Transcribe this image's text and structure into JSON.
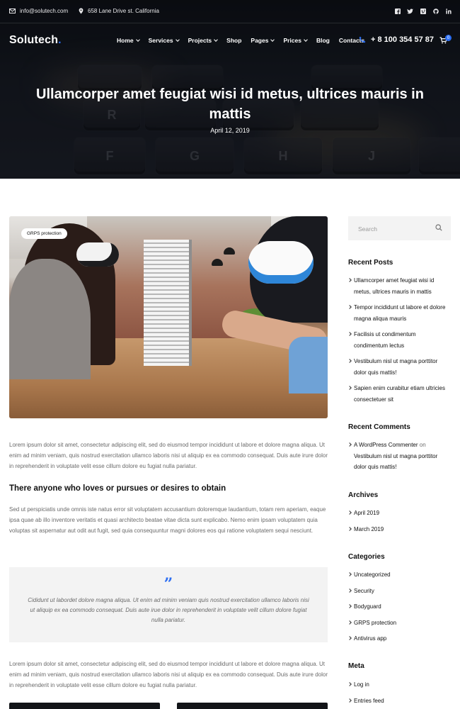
{
  "topbar": {
    "email": "info@solutech.com",
    "address": "658 Lane Drive st. California",
    "socials": [
      "facebook-icon",
      "twitter-icon",
      "vimeo-icon",
      "github-icon",
      "linkedin-icon"
    ]
  },
  "nav": {
    "logo": "Solutech",
    "items": [
      {
        "label": "Home",
        "dropdown": true
      },
      {
        "label": "Services",
        "dropdown": true
      },
      {
        "label": "Projects",
        "dropdown": true
      },
      {
        "label": "Shop",
        "dropdown": false
      },
      {
        "label": "Pages",
        "dropdown": true
      },
      {
        "label": "Prices",
        "dropdown": true
      },
      {
        "label": "Blog",
        "dropdown": false
      },
      {
        "label": "Contacts",
        "dropdown": false
      }
    ],
    "phone": "+ 8 100 354 57 87",
    "cart_count": "0"
  },
  "hero": {
    "title": "Ullamcorper amet feugiat wisi id metus, ultrices mauris in mattis",
    "date": "April 12, 2019",
    "keys": [
      "R",
      "F",
      "G",
      "H",
      "J"
    ]
  },
  "article": {
    "image_tag": "GRPS protection",
    "p1": "Lorem ipsum dolor sit amet, consectetur adipiscing elit, sed do eiusmod tempor incididunt ut labore et dolore magna aliqua. Ut enim ad minim veniam, quis nostrud exercitation ullamco laboris nisi ut aliquip ex ea commodo consequat. Duis aute irure dolor in reprehenderit in voluptate velit esse cillum dolore eu fugiat nulla pariatur.",
    "heading": "There anyone who loves or pursues or desires to obtain",
    "p2": "Sed ut perspiciatis unde omnis iste natus error sit voluptatem accusantium doloremque laudantium, totam rem aperiam, eaque ipsa quae ab illo inventore veritatis et quasi architecto beatae vitae dicta sunt explicabo. Nemo enim ipsam voluptatem quia voluptas sit aspernatur aut odit aut fugit, sed quia consequuntur magni dolores eos qui ratione voluptatem sequi nesciunt.",
    "quote": "Cididunt ut labordet dolore magna aliqua. Ut enim ad minim veniam quis nostrud exercitation ullamco laboris nisi ut aliquip ex ea commodo consequat. Duis aute irue dolor in reprehenderit in voluptate velit cillum dolore fugiat nulla pariatur.",
    "p3": "Lorem ipsum dolor sit amet, consectetur adipiscing elit, sed do eiusmod tempor incididunt ut labore et dolore magna aliqua. Ut enim ad minim veniam, quis nostrud exercitation ullamco laboris nisi ut aliquip ex ea commodo consequat. Duis aute irure dolor in reprehenderit in voluptate velit esse cillum dolore eu fugiat nulla pariatur."
  },
  "sidebar": {
    "search_placeholder": "Search",
    "recent_posts_title": "Recent Posts",
    "recent_posts": [
      "Ullamcorper amet feugiat wisi id metus, ultrices mauris in mattis",
      "Tempor incididunt ut labore et dolore magna aliqua mauris",
      "Facilisis ut condimentum condimentum lectus",
      "Vestibulum nisl ut magna porttitor dolor quis mattis!",
      "Sapien enim curabitur etiam ultricies consectetuer sit"
    ],
    "recent_comments_title": "Recent Comments",
    "comment_author": "A WordPress Commenter",
    "comment_on": "on",
    "comment_post": "Vestibulum nisl ut magna porttitor dolor quis mattis!",
    "archives_title": "Archives",
    "archives": [
      "April 2019",
      "March 2019"
    ],
    "categories_title": "Categories",
    "categories": [
      "Uncategorized",
      "Security",
      "Bodyguard",
      "GRPS protection",
      "Antivirus app"
    ],
    "meta_title": "Meta",
    "meta": [
      "Log in",
      "Entries feed"
    ]
  },
  "colors": {
    "accent": "#2c6ef2",
    "quote_bg": "#f3f3f3",
    "text_muted": "#6a6a6a"
  }
}
